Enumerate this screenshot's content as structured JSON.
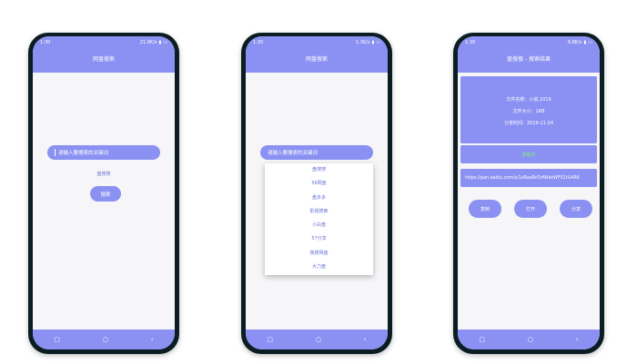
{
  "phones": [
    {
      "status": {
        "time": "1:30",
        "right": "21.8K/s"
      },
      "title": "网盘搜索",
      "search_placeholder": "请输入要搜索的关键词",
      "engine": "盘搜搜",
      "search_button": "搜索"
    },
    {
      "status": {
        "time": "1:30",
        "right": "1.3K/s"
      },
      "title": "网盘搜索",
      "search_placeholder": "请输入要搜索的关键词",
      "dropdown": [
        "盘搜搜",
        "56网盘",
        "盘多多",
        "影视搜索",
        "小白盘",
        "57分享",
        "我搜网盘",
        "大力盘"
      ]
    },
    {
      "status": {
        "time": "1:30",
        "right": "6.8K/s"
      },
      "title": "盘搜搜 - 搜索结果",
      "file_name": "文件名称：小说.2019",
      "file_size": "文件大小：1KB",
      "share_time": "分享时间：2019-11-24",
      "status_text": "获取中",
      "url": "https://pan.baidu.com/s/1xRaaRrDrANdzWFX1tUAR6",
      "buttons": [
        "复制",
        "打开",
        "分享"
      ]
    }
  ],
  "nav": {
    "back": "▢",
    "home": "○",
    "recent": "‹"
  },
  "colors": {
    "accent": "#8b91f2",
    "frame": "#0b1c22",
    "screen": "#f6f6f8",
    "ok": "#7ef07a"
  }
}
